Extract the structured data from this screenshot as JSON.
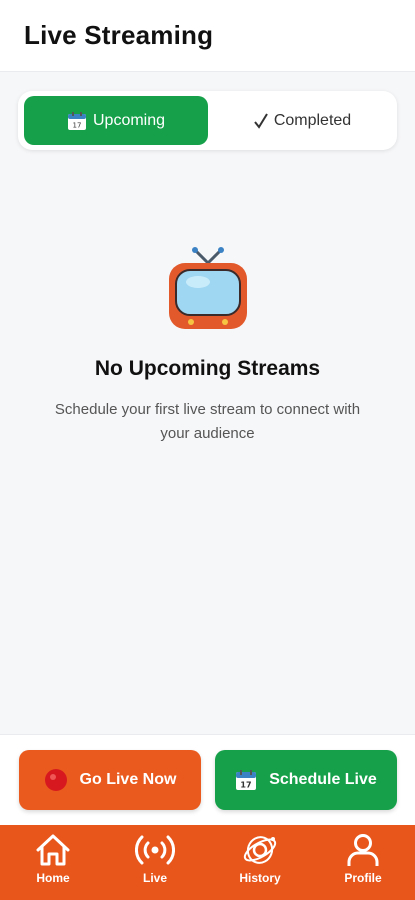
{
  "header": {
    "title": "Live Streaming"
  },
  "tabs": [
    {
      "label": "Upcoming",
      "icon": "calendar-icon",
      "active": true
    },
    {
      "label": "Completed",
      "icon": "checkmark-icon",
      "active": false
    }
  ],
  "empty_state": {
    "icon": "tv-icon",
    "title": "No Upcoming Streams",
    "subtitle": "Schedule your first live stream to connect with your audience"
  },
  "actions": {
    "go_live": {
      "label": "Go Live Now",
      "icon": "red-circle-icon",
      "color": "#ea5a1e"
    },
    "schedule": {
      "label": "Schedule Live",
      "icon": "calendar-icon",
      "color": "#15a049"
    }
  },
  "nav": [
    {
      "label": "Home",
      "icon": "home-icon"
    },
    {
      "label": "Live",
      "icon": "broadcast-icon"
    },
    {
      "label": "History",
      "icon": "history-icon"
    },
    {
      "label": "Profile",
      "icon": "profile-icon"
    }
  ],
  "colors": {
    "accent_green": "#15a049",
    "accent_orange": "#e8561c"
  }
}
